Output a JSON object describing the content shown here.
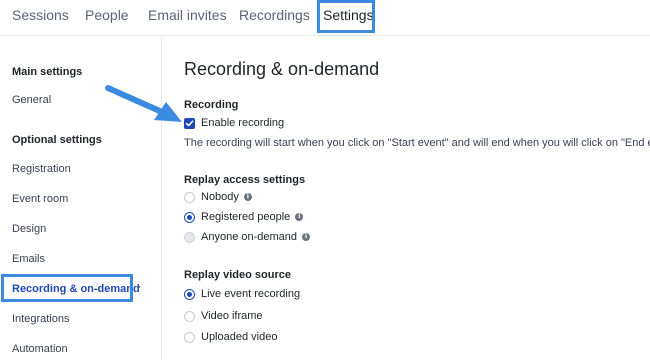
{
  "tabs": [
    {
      "label": "Sessions"
    },
    {
      "label": "People"
    },
    {
      "label": "Email invites"
    },
    {
      "label": "Recordings"
    },
    {
      "label": "Settings",
      "active": true
    }
  ],
  "sidebar": {
    "main_heading": "Main settings",
    "main_items": [
      {
        "label": "General"
      }
    ],
    "optional_heading": "Optional settings",
    "optional_items": [
      {
        "label": "Registration"
      },
      {
        "label": "Event room"
      },
      {
        "label": "Design"
      },
      {
        "label": "Emails"
      },
      {
        "label": "Recording & on-demand",
        "active": true
      },
      {
        "label": "Integrations"
      },
      {
        "label": "Automation"
      }
    ],
    "chevron": "›"
  },
  "main": {
    "title": "Recording & on-demand",
    "recording": {
      "heading": "Recording",
      "checkbox_label": "Enable recording",
      "checked": true,
      "description": "The recording will start when you click on \"Start event\" and will end when you will click on \"End event\"."
    },
    "replay_access": {
      "heading": "Replay access settings",
      "options": [
        {
          "label": "Nobody",
          "selected": false,
          "info": true
        },
        {
          "label": "Registered people",
          "selected": true,
          "info": true
        },
        {
          "label": "Anyone on-demand",
          "selected": false,
          "disabled": true,
          "info": true
        }
      ]
    },
    "replay_source": {
      "heading": "Replay video source",
      "options": [
        {
          "label": "Live event recording",
          "selected": true
        },
        {
          "label": "Video iframe",
          "selected": false
        },
        {
          "label": "Uploaded video",
          "selected": false
        }
      ]
    }
  },
  "colors": {
    "accent": "#1f49b6",
    "highlight": "#3b8be3"
  },
  "icons": {
    "info": "i",
    "check": "check-icon",
    "arrow": "arrow-annotation-icon"
  }
}
